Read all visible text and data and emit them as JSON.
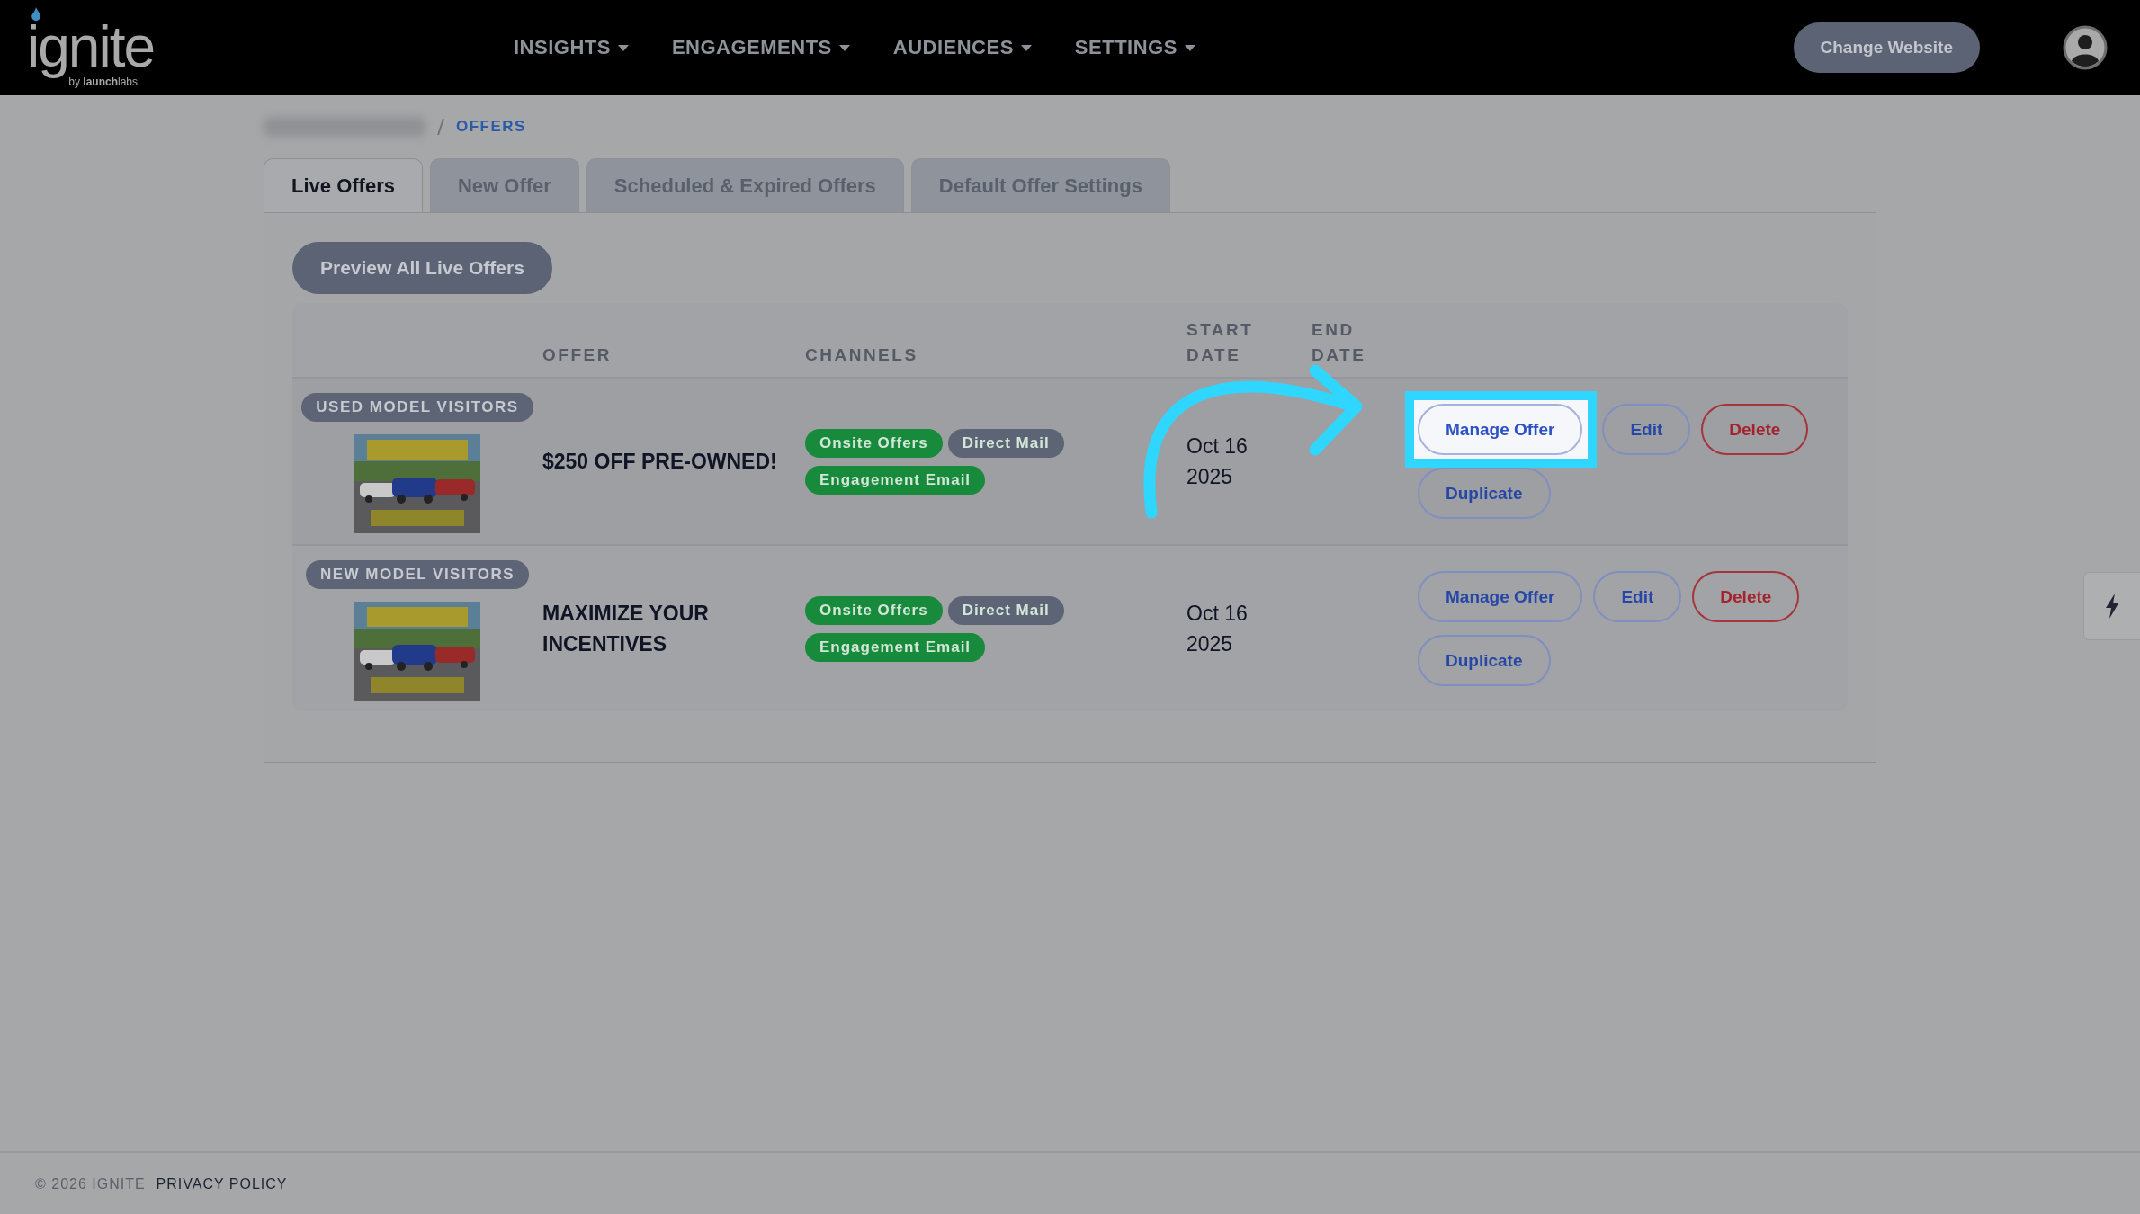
{
  "header": {
    "logo": {
      "word": "ignite",
      "tagline": "by **launch**labs"
    },
    "nav": [
      {
        "label": "INSIGHTS"
      },
      {
        "label": "ENGAGEMENTS"
      },
      {
        "label": "AUDIENCES"
      },
      {
        "label": "SETTINGS"
      }
    ],
    "change_website": "Change Website"
  },
  "breadcrumb": {
    "current": "OFFERS"
  },
  "tabs": [
    {
      "label": "Live Offers",
      "selected": true
    },
    {
      "label": "New Offer",
      "selected": false
    },
    {
      "label": "Scheduled & Expired Offers",
      "selected": false
    },
    {
      "label": "Default Offer Settings",
      "selected": false
    }
  ],
  "preview_button": "Preview All Live Offers",
  "table": {
    "columns": [
      "OFFER",
      "CHANNELS",
      "START DATE",
      "END DATE"
    ],
    "rows": [
      {
        "audience": "USED MODEL VISITORS",
        "image": {
          "kind": "picture"
        },
        "offer": "$250 OFF PRE-OWNED!",
        "channels": [
          {
            "label": "Onsite Offers",
            "color": "#178a3c"
          },
          {
            "label": "Direct Mail",
            "color": "#5d6475"
          },
          {
            "label": "Engagement Email",
            "color": "#178a3c"
          }
        ],
        "start_date": [
          "Oct 16",
          "2025"
        ],
        "actions": [
          {
            "label": "Manage Offer",
            "kind": "primary",
            "highlighted": true
          },
          {
            "label": "Edit",
            "kind": "primary",
            "highlighted": false
          },
          {
            "label": "Delete",
            "kind": "danger",
            "highlighted": false
          },
          {
            "label": "Duplicate",
            "kind": "primary",
            "highlighted": false
          }
        ]
      },
      {
        "audience": "NEW MODEL VISITORS",
        "image": {
          "kind": "picture"
        },
        "offer": "MAXIMIZE YOUR INCENTIVES",
        "channels": [
          {
            "label": "Onsite Offers",
            "color": "#178a3c"
          },
          {
            "label": "Direct Mail",
            "color": "#5d6475"
          },
          {
            "label": "Engagement Email",
            "color": "#178a3c"
          }
        ],
        "start_date": [
          "Oct 16",
          "2025"
        ],
        "actions": [
          {
            "label": "Manage Offer",
            "kind": "primary",
            "highlighted": false
          },
          {
            "label": "Edit",
            "kind": "primary",
            "highlighted": false
          },
          {
            "label": "Delete",
            "kind": "danger",
            "highlighted": false
          },
          {
            "label": "Duplicate",
            "kind": "primary",
            "highlighted": false
          }
        ]
      }
    ]
  },
  "footer": {
    "copyright": "© 2026 IGNITE",
    "link": "PRIVACY POLICY"
  }
}
